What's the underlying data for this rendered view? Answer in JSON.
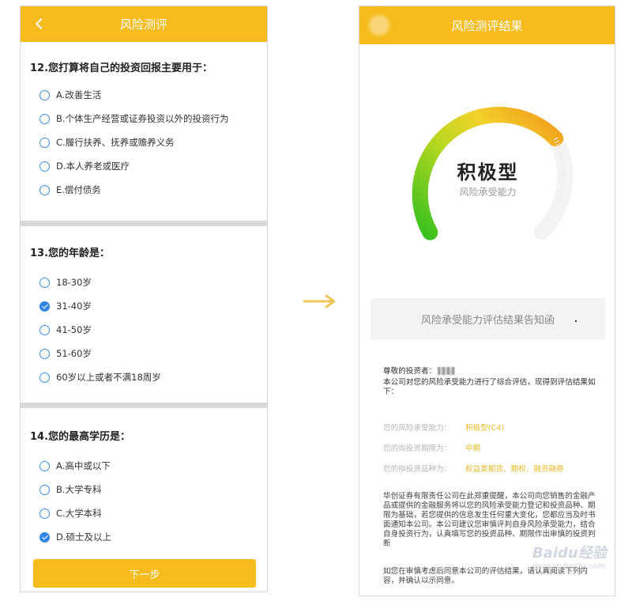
{
  "left_screen": {
    "title": "风险测评",
    "questions": [
      {
        "title": "12.您打算将自己的投资回报主要用于：",
        "options": [
          "A.改善生活",
          "B.个体生产经营或证券投资以外的投资行为",
          "C.履行扶养、抚养或赡养义务",
          "D.本人养老或医疗",
          "E.偿付债务"
        ],
        "selected": -1
      },
      {
        "title": "13.您的年龄是：",
        "options": [
          "18-30岁",
          "31-40岁",
          "41-50岁",
          "51-60岁",
          "60岁以上或者不满18周岁"
        ],
        "selected": 1
      },
      {
        "title": "14.您的最高学历是：",
        "options": [
          "A.高中或以下",
          "B.大学专科",
          "C.大学本科",
          "D.硕士及以上"
        ],
        "selected": 3
      }
    ],
    "next_label": "下一步"
  },
  "right_screen": {
    "title": "风险测评结果",
    "result_type": "积极型",
    "result_caption": "风险承受能力",
    "notice_label": "风险承受能力评估结果告知函",
    "greeting": "尊敬的投资者：",
    "intro": "本公司对您的风险承受能力进行了综合评估，现得到评估结果如下：",
    "summary": [
      {
        "label": "您的风险承受能力：",
        "value": "积极型(C4)"
      },
      {
        "label": "您的拟投资期限为：",
        "value": "中期"
      },
      {
        "label": "您的拟投资品种为：",
        "value": "权益类期货、期权、融资融券"
      }
    ],
    "disclaimer": "华创证券有限责任公司在此郑重提醒，本公司向您销售的金融产品或提供的金融服务将以您的风险承受能力登记和投资品种、期限为基础，若您提供的信息发生任何重大变化，您都应当及时书面通知本公司。本公司建议您审慎评判自身风险承受能力，结合自身投资行为，认真填写您的投资品种、期限作出审慎的投资判断",
    "closing": "如您在审慎考虑后同意本公司的评估结果，请认真阅读下列内容，并确认以示同意。"
  },
  "watermark": {
    "line1": "Baidu经验",
    "line2": "jingyan.baidu.com"
  },
  "colors": {
    "brand_yellow": "#f6bb1c",
    "radio_blue": "#2f86e6",
    "value_gold": "#e8b824"
  },
  "icons": {
    "back": "chevron-left-icon",
    "arrow": "right-arrow-icon"
  }
}
